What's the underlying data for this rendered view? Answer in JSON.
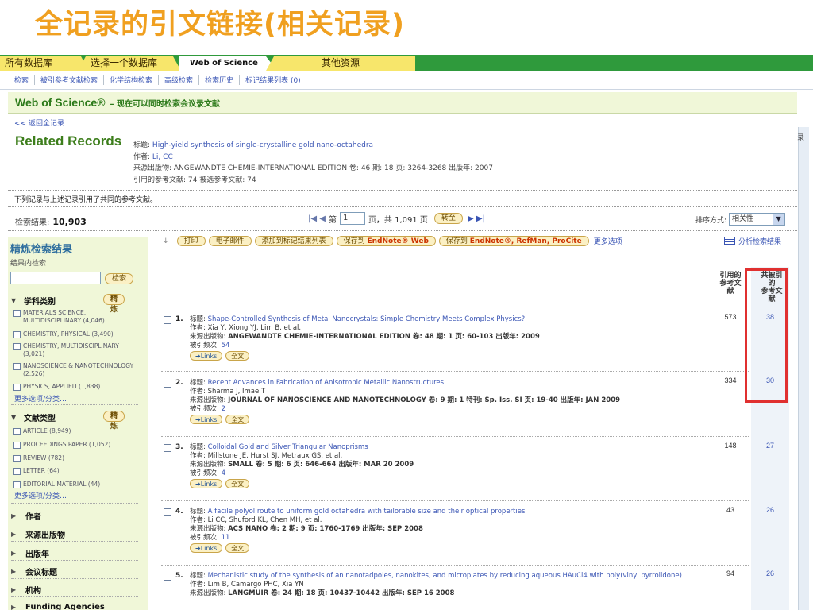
{
  "slide": {
    "title": "全记录的引文链接(相关记录)"
  },
  "topnav": {
    "tab1": "所有数据库",
    "tab2": "选择一个数据库",
    "tab3": "Web of Science",
    "tab4": "其他资源"
  },
  "subnav": [
    "检索",
    "被引参考文献检索",
    "化学结构检索",
    "高级检索",
    "检索历史",
    "标记结果列表 (0)"
  ],
  "header": {
    "wos": "Web of Science®",
    "sub": "– 现在可以同时检索会议录文献"
  },
  "back_link": "<< 返回全记录",
  "related": {
    "heading": "Related Records",
    "line1_label": "标题:",
    "line1_value": "High-yield synthesis of single-crystalline gold nano-octahedra",
    "line2_label": "作者:",
    "line2_value": "Li, CC",
    "line3": "来源出版物: ANGEWANDTE CHEMIE-INTERNATIONAL EDITION 卷: 46 期: 18 页: 3264-3268 出版年: 2007",
    "line4": "引用的参考文献: 74 被选参考文献: 74"
  },
  "common_note": "下列记录与上述记录引用了共同的参考文献。",
  "results": {
    "label": "检索结果:",
    "count": "10,903"
  },
  "pager": {
    "first_prev": "|◀ ◀",
    "page_label": "第",
    "page_value": "1",
    "total": "页，共 1,091 页",
    "go": "转至",
    "next_last": "▶ ▶|"
  },
  "sort": {
    "label": "排序方式:",
    "value": "相关性",
    "arrow": "▼"
  },
  "toolbar": {
    "corner": "↓",
    "print": "打印",
    "email": "电子邮件",
    "add_marked": "添加到标记结果列表",
    "save_web_prefix": "保存到",
    "save_web_brand": "EndNote® Web",
    "save_desk_prefix": "保存到",
    "save_desk_brand": "EndNote®, RefMan, ProCite",
    "more": "更多选项"
  },
  "analyze": "分析检索结果",
  "sidebar": {
    "title": "精炼检索结果",
    "subtitle": "结果内检索",
    "search_btn": "检索",
    "refine_btn": "精炼",
    "subject_heading": "学科类别",
    "subjects": [
      "MATERIALS SCIENCE, MULTIDISCIPLINARY (4,046)",
      "CHEMISTRY, PHYSICAL (3,490)",
      "CHEMISTRY, MULTIDISCIPLINARY (3,021)",
      "NANOSCIENCE & NANOTECHNOLOGY (2,526)",
      "PHYSICS, APPLIED (1,838)"
    ],
    "more_subjects": "更多选项/分类…",
    "doctype_heading": "文献类型",
    "doctypes": [
      "ARTICLE (8,949)",
      "PROCEEDINGS PAPER (1,052)",
      "REVIEW (782)",
      "LETTER (64)",
      "EDITORIAL MATERIAL (44)"
    ],
    "more_doctypes": "更多选项/分类…",
    "collapsed": [
      "作者",
      "来源出版物",
      "出版年",
      "会议标题",
      "机构",
      "Funding Agencies"
    ]
  },
  "columns": {
    "cited_l1": "引用的",
    "cited_l2": "参考文",
    "cited_l3": "献",
    "shared_l1": "共被引",
    "shared_l2": "的",
    "shared_l3": "参考文",
    "shared_l4": "献"
  },
  "records": [
    {
      "num": "1.",
      "title": "Shape-Controlled Synthesis of Metal Nanocrystals: Simple Chemistry Meets Complex Physics?",
      "authors": "Xia Y, Xiong YJ, Lim B, et al.",
      "source": "ANGEWANDTE CHEMIE-INTERNATIONAL EDITION  卷: 48  期: 1  页: 60-103  出版年: 2009",
      "cited_by": "54",
      "cited_refs": "573",
      "shared_refs": "38"
    },
    {
      "num": "2.",
      "title": "Recent Advances in Fabrication of Anisotropic Metallic Nanostructures",
      "authors": "Sharma J, Imae T",
      "source": "JOURNAL OF NANOSCIENCE AND NANOTECHNOLOGY  卷: 9  期: 1  特刊: Sp. Iss. SI  页: 19-40  出版年: JAN 2009",
      "cited_by": "2",
      "cited_refs": "334",
      "shared_refs": "30"
    },
    {
      "num": "3.",
      "title": "Colloidal Gold and Silver Triangular Nanoprisms",
      "authors": "Millstone JE, Hurst SJ, Metraux GS, et al.",
      "source": "SMALL  卷: 5  期: 6  页: 646-664  出版年: MAR 20 2009",
      "cited_by": "4",
      "cited_refs": "148",
      "shared_refs": "27"
    },
    {
      "num": "4.",
      "title": "A facile polyol route to uniform gold octahedra with tailorable size and their optical properties",
      "authors": "Li CC, Shuford KL, Chen MH, et al.",
      "source": "ACS NANO  卷: 2  期: 9  页: 1760-1769  出版年: SEP 2008",
      "cited_by": "11",
      "cited_refs": "43",
      "shared_refs": "26"
    },
    {
      "num": "5.",
      "title": "Mechanistic study of the synthesis of an nanotadpoles, nanokites, and microplates by reducing aqueous HAuCl4 with poly(vinyl pyrrolidone)",
      "authors": "Lim B, Camargo PHC, Xia YN",
      "source": "LANGMUIR  卷: 24  期: 18  页: 10437-10442  出版年: SEP 16 2008",
      "cited_by": "",
      "cited_refs": "94",
      "shared_refs": "26"
    }
  ],
  "labels": {
    "title": "标题:",
    "author": "作者:",
    "source": "来源出版物:",
    "cited_by": "被引频次:",
    "links": "➔Links",
    "fulltext": "全文"
  },
  "edge_text": "录"
}
